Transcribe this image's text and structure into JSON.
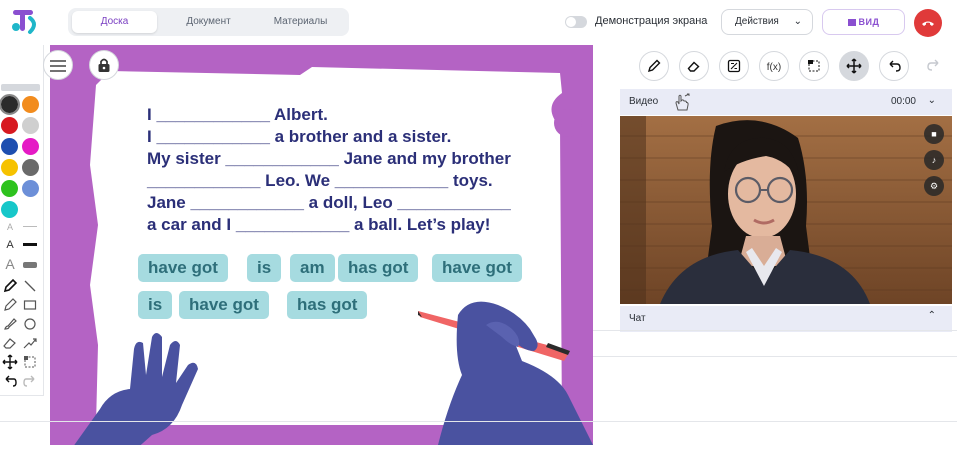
{
  "header": {
    "tabs": [
      {
        "label": "Доска",
        "active": true
      },
      {
        "label": "Документ",
        "active": false
      },
      {
        "label": "Материалы",
        "active": false
      }
    ],
    "screen_share_label": "Демонстрация экрана",
    "actions_label": "Действия",
    "view_label": "ВИД"
  },
  "palette": {
    "colors": [
      "#2b2b2b",
      "#f28c1e",
      "#d71920",
      "#cfcfcf",
      "#1e4fb0",
      "#e51ac5",
      "#f6c200",
      "#6a6a6a",
      "#2ec21e",
      "#6c8fd8",
      "#17c7c9"
    ]
  },
  "board": {
    "lines": [
      "I ____________ Albert.",
      "I ____________ a brother and a sister.",
      "My sister ____________ Jane and my brother",
      "____________ Leo. We ____________ toys.",
      "Jane ____________ a doll, Leo ____________",
      "a car and I ____________ a ball. Let’s play!"
    ],
    "chips_row1": [
      "have got",
      "is",
      "am",
      "has got",
      "have got"
    ],
    "chips_row2": [
      "is",
      "have got",
      "has got"
    ],
    "colors": {
      "frame": "#b463c4",
      "text": "#2b2f78",
      "chip_bg": "#a6dbe0",
      "chip_text": "#2e6f7a",
      "hand": "#4a52a0"
    }
  },
  "toolbar_right": {
    "function_label": "f(x)"
  },
  "video_panel": {
    "title": "Видео",
    "time": "00:00"
  },
  "chat_panel": {
    "title": "Чат"
  }
}
